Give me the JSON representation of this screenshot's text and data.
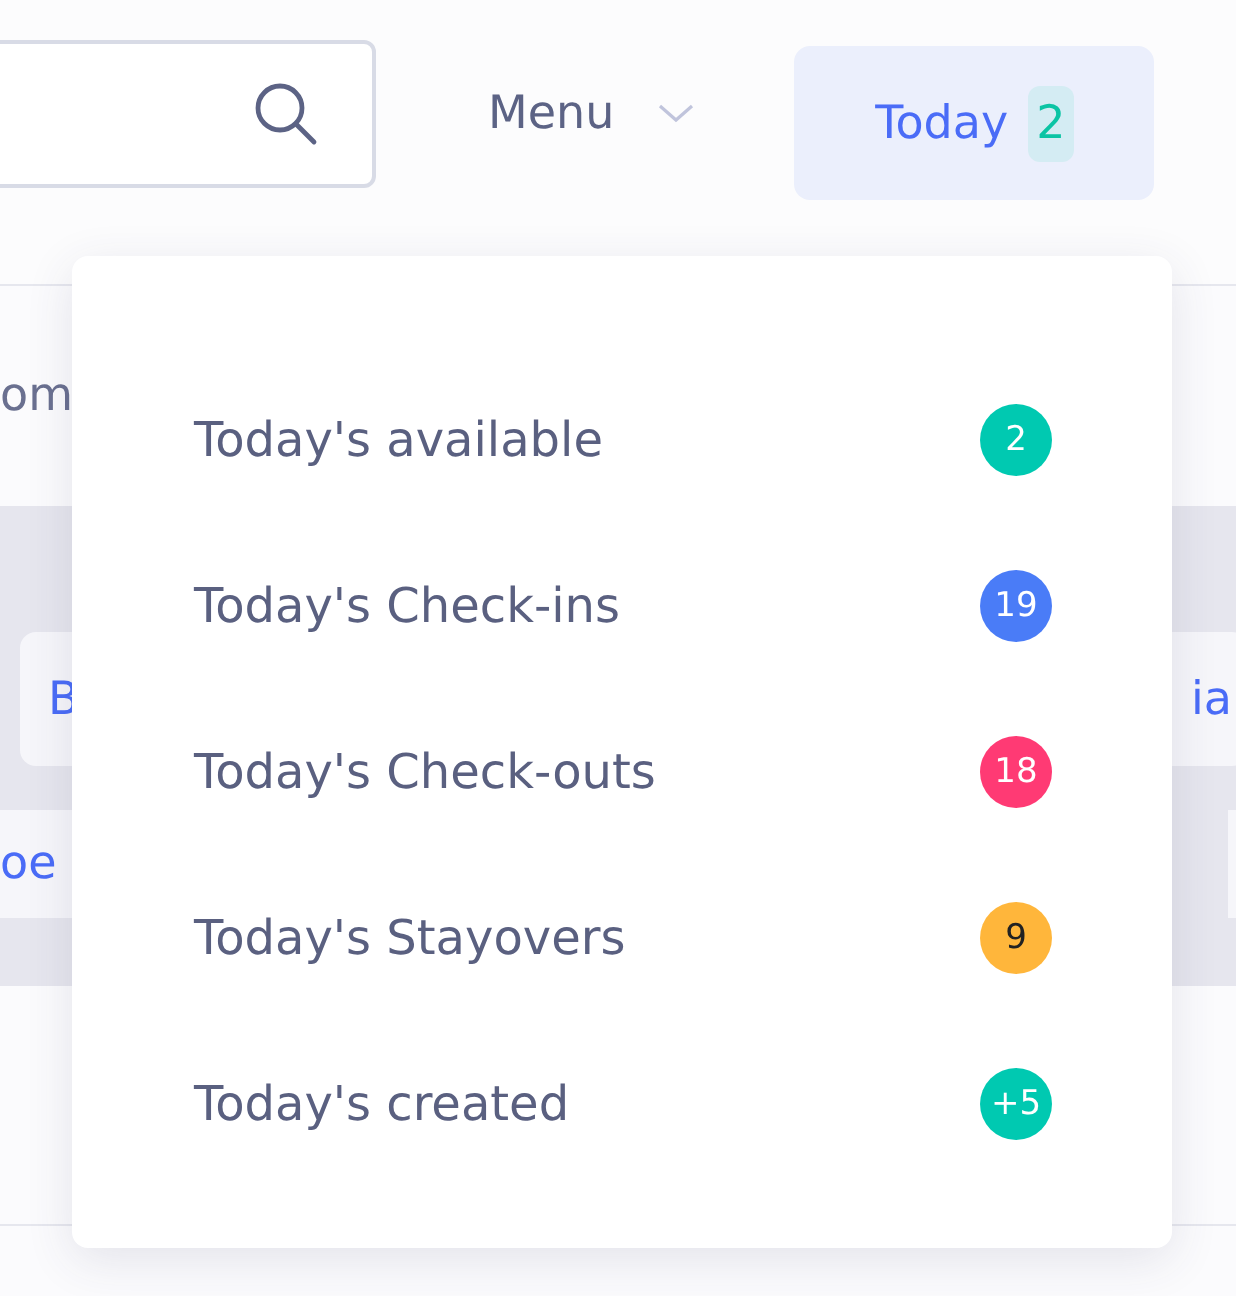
{
  "header": {
    "menu": {
      "label": "Menu"
    },
    "today": {
      "label": "Today",
      "count": "2",
      "selected": true
    }
  },
  "page_behind": {
    "section_label": "om",
    "chips_row_1": [
      "B",
      "ia"
    ],
    "chips_row_2": [
      "oe"
    ]
  },
  "today_menu": {
    "items": [
      {
        "label": "Today's available",
        "count": "2",
        "color": "#00c9b1"
      },
      {
        "label": "Today's Check-ins",
        "count": "19",
        "color": "#4a7cf7"
      },
      {
        "label": "Today's Check-outs",
        "count": "18",
        "color": "#ff3a74"
      },
      {
        "label": "Today's Stayovers",
        "count": "9",
        "color": "#ffb63b"
      },
      {
        "label": "Today's created",
        "count": "+5",
        "color": "#00c9b1"
      }
    ]
  }
}
